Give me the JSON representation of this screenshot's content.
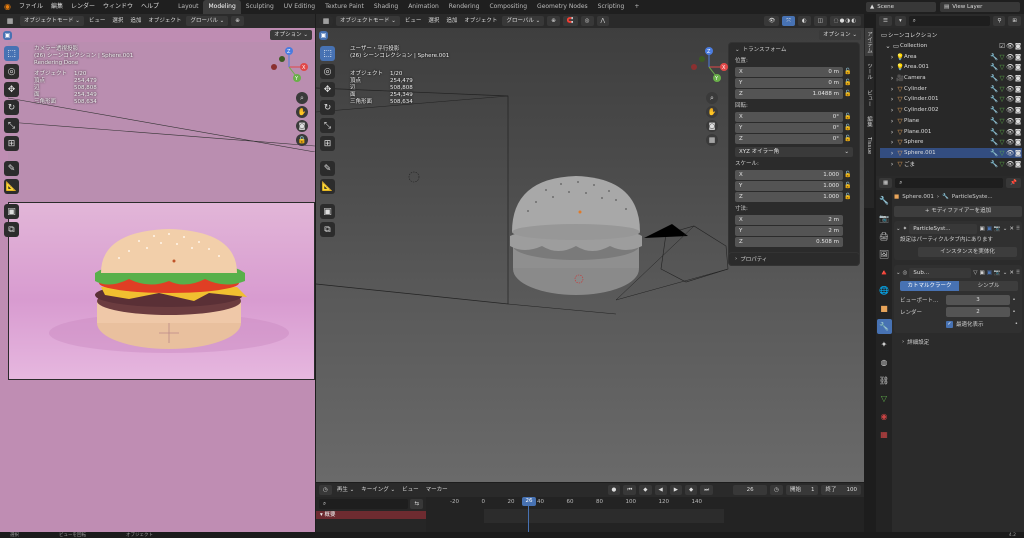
{
  "menu": {
    "items": [
      "ファイル",
      "編集",
      "レンダー",
      "ウィンドウ",
      "ヘルプ"
    ],
    "workspaces": [
      "Layout",
      "Modeling",
      "Sculpting",
      "UV Editing",
      "Texture Paint",
      "Shading",
      "Animation",
      "Rendering",
      "Compositing",
      "Geometry Nodes",
      "Scripting"
    ],
    "active_workspace": "Modeling",
    "add_tab": "+",
    "scene": "Scene",
    "view_layer": "View Layer"
  },
  "left_view": {
    "mode": "オブジェクトモード",
    "view": "ビュー",
    "select": "選択",
    "add": "追加",
    "object": "オブジェクト",
    "transform": "グローバル",
    "options": "オプション",
    "camera_title": "カメラー透視投影",
    "collection_path": "(26) シーンコレクション | Sphere.001",
    "rendering": "Rendering Done",
    "stats": [
      {
        "label": "オブジェクト",
        "value": "1/20"
      },
      {
        "label": "頂点",
        "value": "254,479"
      },
      {
        "label": "辺",
        "value": "508,808"
      },
      {
        "label": "面",
        "value": "254,349"
      },
      {
        "label": "三角形面",
        "value": "508,634"
      }
    ]
  },
  "main_view": {
    "mode": "オブジェクトモード",
    "view": "ビュー",
    "select": "選択",
    "add": "追加",
    "object": "オブジェクト",
    "transform": "グローバル",
    "options": "オプション",
    "persp_title": "ユーザー・平行投影",
    "collection_path": "(26) シーンコレクション | Sphere.001",
    "stats": [
      {
        "label": "オブジェクト",
        "value": "1/20"
      },
      {
        "label": "頂点",
        "value": "254,479"
      },
      {
        "label": "辺",
        "value": "508,808"
      },
      {
        "label": "面",
        "value": "254,349"
      },
      {
        "label": "三角形面",
        "value": "508,634"
      }
    ],
    "tabs": [
      "アイテム",
      "ツール",
      "ビュー",
      "編集",
      "Tissue"
    ]
  },
  "npanel": {
    "title": "トランスフォーム",
    "location_label": "位置:",
    "location": [
      {
        "axis": "X",
        "value": "0 m"
      },
      {
        "axis": "Y",
        "value": "0 m"
      },
      {
        "axis": "Z",
        "value": "1.0488 m"
      }
    ],
    "rotation_label": "回転:",
    "rotation": [
      {
        "axis": "X",
        "value": "0°"
      },
      {
        "axis": "Y",
        "value": "0°"
      },
      {
        "axis": "Z",
        "value": "0°"
      }
    ],
    "rotation_mode": "XYZ オイラー角",
    "scale_label": "スケール:",
    "scale": [
      {
        "axis": "X",
        "value": "1.000"
      },
      {
        "axis": "Y",
        "value": "1.000"
      },
      {
        "axis": "Z",
        "value": "1.000"
      }
    ],
    "dimensions_label": "寸法:",
    "dimensions": [
      {
        "axis": "X",
        "value": "2 m"
      },
      {
        "axis": "Y",
        "value": "2 m"
      },
      {
        "axis": "Z",
        "value": "0.508 m"
      }
    ],
    "properties": "プロパティ"
  },
  "outliner": {
    "search_placeholder": "",
    "scene_collection": "シーンコレクション",
    "collection": "Collection",
    "items": [
      {
        "name": "Area",
        "icon": "light-icon",
        "color": "#e8a45a"
      },
      {
        "name": "Area.001",
        "icon": "light-icon",
        "color": "#e8a45a"
      },
      {
        "name": "Camera",
        "icon": "camera-icon",
        "color": "#e8a45a"
      },
      {
        "name": "Cylinder",
        "icon": "mesh-icon",
        "color": "#e8a45a"
      },
      {
        "name": "Cylinder.001",
        "icon": "mesh-icon",
        "color": "#e8a45a"
      },
      {
        "name": "Cylinder.002",
        "icon": "mesh-icon",
        "color": "#e8a45a"
      },
      {
        "name": "Plane",
        "icon": "mesh-icon",
        "color": "#e8a45a"
      },
      {
        "name": "Plane.001",
        "icon": "mesh-icon",
        "color": "#e8a45a"
      },
      {
        "name": "Sphere",
        "icon": "mesh-icon",
        "color": "#e8a45a"
      },
      {
        "name": "Sphere.001",
        "icon": "mesh-icon",
        "color": "#e8a45a"
      },
      {
        "name": "ごま",
        "icon": "mesh-icon",
        "color": "#e8a45a"
      }
    ]
  },
  "properties": {
    "search_placeholder": "",
    "breadcrumb_object": "Sphere.001",
    "breadcrumb_modifier": "ParticleSyste...",
    "add_modifier": "モディファイアーを追加",
    "particle_modifier": "ParticleSyst...",
    "particle_note": "設定はパーティクルタブ内にあります",
    "make_instances": "インスタンスを実体化",
    "subsurf_name": "Sub...",
    "catmull": "カトマルクラーク",
    "simple": "シンプル",
    "viewport_label": "ビューポート...",
    "viewport_value": "3",
    "render_label": "レンダー",
    "render_value": "2",
    "optimal_display": "最適化表示",
    "advanced": "詳細設定"
  },
  "timeline": {
    "playback": "再生",
    "keying": "キーイング",
    "view": "ビュー",
    "marker": "マーカー",
    "current_frame": "26",
    "start_label": "開始",
    "start": "1",
    "end_label": "終了",
    "end": "100",
    "ticks": [
      "-20",
      "0",
      "20",
      "40",
      "60",
      "80",
      "100",
      "120",
      "140"
    ],
    "summary": "概要"
  },
  "statusbar": {
    "left": "選択",
    "mid": "ビューを回転",
    "right": "オブジェクト",
    "version": "4.2"
  }
}
